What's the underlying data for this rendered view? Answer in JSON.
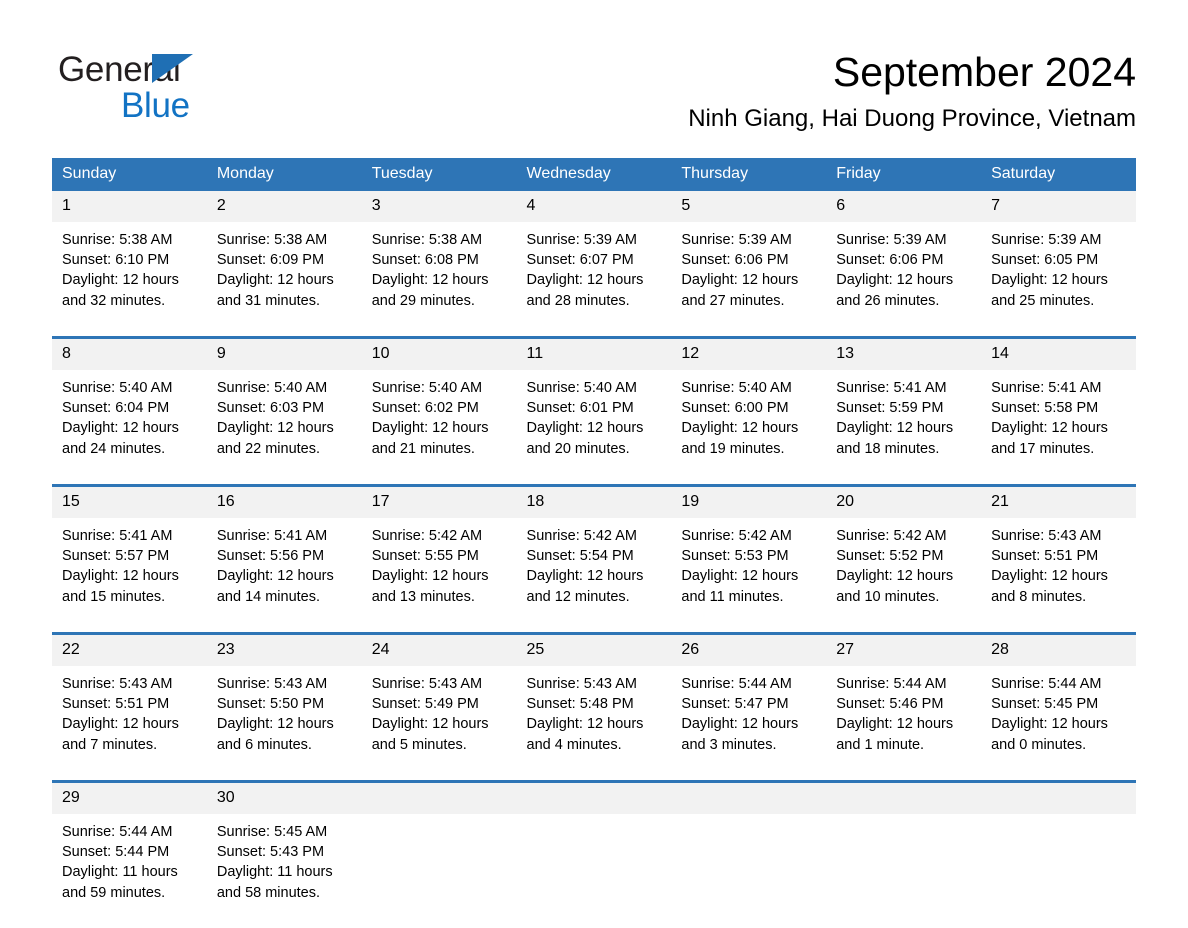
{
  "brand": {
    "name_part1": "General",
    "name_part2": "Blue",
    "accent_color": "#1273c4",
    "triangle_color": "#1f6fb4"
  },
  "header": {
    "title": "September 2024",
    "subtitle": "Ninh Giang, Hai Duong Province, Vietnam"
  },
  "calendar": {
    "header_bg": "#2e75b6",
    "daynum_bg": "#f2f2f2",
    "weekday_headers": [
      "Sunday",
      "Monday",
      "Tuesday",
      "Wednesday",
      "Thursday",
      "Friday",
      "Saturday"
    ],
    "weeks": [
      [
        {
          "day": "1",
          "sunrise": "Sunrise: 5:38 AM",
          "sunset": "Sunset: 6:10 PM",
          "daylight_line1": "Daylight: 12 hours",
          "daylight_line2": "and 32 minutes."
        },
        {
          "day": "2",
          "sunrise": "Sunrise: 5:38 AM",
          "sunset": "Sunset: 6:09 PM",
          "daylight_line1": "Daylight: 12 hours",
          "daylight_line2": "and 31 minutes."
        },
        {
          "day": "3",
          "sunrise": "Sunrise: 5:38 AM",
          "sunset": "Sunset: 6:08 PM",
          "daylight_line1": "Daylight: 12 hours",
          "daylight_line2": "and 29 minutes."
        },
        {
          "day": "4",
          "sunrise": "Sunrise: 5:39 AM",
          "sunset": "Sunset: 6:07 PM",
          "daylight_line1": "Daylight: 12 hours",
          "daylight_line2": "and 28 minutes."
        },
        {
          "day": "5",
          "sunrise": "Sunrise: 5:39 AM",
          "sunset": "Sunset: 6:06 PM",
          "daylight_line1": "Daylight: 12 hours",
          "daylight_line2": "and 27 minutes."
        },
        {
          "day": "6",
          "sunrise": "Sunrise: 5:39 AM",
          "sunset": "Sunset: 6:06 PM",
          "daylight_line1": "Daylight: 12 hours",
          "daylight_line2": "and 26 minutes."
        },
        {
          "day": "7",
          "sunrise": "Sunrise: 5:39 AM",
          "sunset": "Sunset: 6:05 PM",
          "daylight_line1": "Daylight: 12 hours",
          "daylight_line2": "and 25 minutes."
        }
      ],
      [
        {
          "day": "8",
          "sunrise": "Sunrise: 5:40 AM",
          "sunset": "Sunset: 6:04 PM",
          "daylight_line1": "Daylight: 12 hours",
          "daylight_line2": "and 24 minutes."
        },
        {
          "day": "9",
          "sunrise": "Sunrise: 5:40 AM",
          "sunset": "Sunset: 6:03 PM",
          "daylight_line1": "Daylight: 12 hours",
          "daylight_line2": "and 22 minutes."
        },
        {
          "day": "10",
          "sunrise": "Sunrise: 5:40 AM",
          "sunset": "Sunset: 6:02 PM",
          "daylight_line1": "Daylight: 12 hours",
          "daylight_line2": "and 21 minutes."
        },
        {
          "day": "11",
          "sunrise": "Sunrise: 5:40 AM",
          "sunset": "Sunset: 6:01 PM",
          "daylight_line1": "Daylight: 12 hours",
          "daylight_line2": "and 20 minutes."
        },
        {
          "day": "12",
          "sunrise": "Sunrise: 5:40 AM",
          "sunset": "Sunset: 6:00 PM",
          "daylight_line1": "Daylight: 12 hours",
          "daylight_line2": "and 19 minutes."
        },
        {
          "day": "13",
          "sunrise": "Sunrise: 5:41 AM",
          "sunset": "Sunset: 5:59 PM",
          "daylight_line1": "Daylight: 12 hours",
          "daylight_line2": "and 18 minutes."
        },
        {
          "day": "14",
          "sunrise": "Sunrise: 5:41 AM",
          "sunset": "Sunset: 5:58 PM",
          "daylight_line1": "Daylight: 12 hours",
          "daylight_line2": "and 17 minutes."
        }
      ],
      [
        {
          "day": "15",
          "sunrise": "Sunrise: 5:41 AM",
          "sunset": "Sunset: 5:57 PM",
          "daylight_line1": "Daylight: 12 hours",
          "daylight_line2": "and 15 minutes."
        },
        {
          "day": "16",
          "sunrise": "Sunrise: 5:41 AM",
          "sunset": "Sunset: 5:56 PM",
          "daylight_line1": "Daylight: 12 hours",
          "daylight_line2": "and 14 minutes."
        },
        {
          "day": "17",
          "sunrise": "Sunrise: 5:42 AM",
          "sunset": "Sunset: 5:55 PM",
          "daylight_line1": "Daylight: 12 hours",
          "daylight_line2": "and 13 minutes."
        },
        {
          "day": "18",
          "sunrise": "Sunrise: 5:42 AM",
          "sunset": "Sunset: 5:54 PM",
          "daylight_line1": "Daylight: 12 hours",
          "daylight_line2": "and 12 minutes."
        },
        {
          "day": "19",
          "sunrise": "Sunrise: 5:42 AM",
          "sunset": "Sunset: 5:53 PM",
          "daylight_line1": "Daylight: 12 hours",
          "daylight_line2": "and 11 minutes."
        },
        {
          "day": "20",
          "sunrise": "Sunrise: 5:42 AM",
          "sunset": "Sunset: 5:52 PM",
          "daylight_line1": "Daylight: 12 hours",
          "daylight_line2": "and 10 minutes."
        },
        {
          "day": "21",
          "sunrise": "Sunrise: 5:43 AM",
          "sunset": "Sunset: 5:51 PM",
          "daylight_line1": "Daylight: 12 hours",
          "daylight_line2": "and 8 minutes."
        }
      ],
      [
        {
          "day": "22",
          "sunrise": "Sunrise: 5:43 AM",
          "sunset": "Sunset: 5:51 PM",
          "daylight_line1": "Daylight: 12 hours",
          "daylight_line2": "and 7 minutes."
        },
        {
          "day": "23",
          "sunrise": "Sunrise: 5:43 AM",
          "sunset": "Sunset: 5:50 PM",
          "daylight_line1": "Daylight: 12 hours",
          "daylight_line2": "and 6 minutes."
        },
        {
          "day": "24",
          "sunrise": "Sunrise: 5:43 AM",
          "sunset": "Sunset: 5:49 PM",
          "daylight_line1": "Daylight: 12 hours",
          "daylight_line2": "and 5 minutes."
        },
        {
          "day": "25",
          "sunrise": "Sunrise: 5:43 AM",
          "sunset": "Sunset: 5:48 PM",
          "daylight_line1": "Daylight: 12 hours",
          "daylight_line2": "and 4 minutes."
        },
        {
          "day": "26",
          "sunrise": "Sunrise: 5:44 AM",
          "sunset": "Sunset: 5:47 PM",
          "daylight_line1": "Daylight: 12 hours",
          "daylight_line2": "and 3 minutes."
        },
        {
          "day": "27",
          "sunrise": "Sunrise: 5:44 AM",
          "sunset": "Sunset: 5:46 PM",
          "daylight_line1": "Daylight: 12 hours",
          "daylight_line2": "and 1 minute."
        },
        {
          "day": "28",
          "sunrise": "Sunrise: 5:44 AM",
          "sunset": "Sunset: 5:45 PM",
          "daylight_line1": "Daylight: 12 hours",
          "daylight_line2": "and 0 minutes."
        }
      ],
      [
        {
          "day": "29",
          "sunrise": "Sunrise: 5:44 AM",
          "sunset": "Sunset: 5:44 PM",
          "daylight_line1": "Daylight: 11 hours",
          "daylight_line2": "and 59 minutes."
        },
        {
          "day": "30",
          "sunrise": "Sunrise: 5:45 AM",
          "sunset": "Sunset: 5:43 PM",
          "daylight_line1": "Daylight: 11 hours",
          "daylight_line2": "and 58 minutes."
        },
        {
          "day": "",
          "sunrise": "",
          "sunset": "",
          "daylight_line1": "",
          "daylight_line2": ""
        },
        {
          "day": "",
          "sunrise": "",
          "sunset": "",
          "daylight_line1": "",
          "daylight_line2": ""
        },
        {
          "day": "",
          "sunrise": "",
          "sunset": "",
          "daylight_line1": "",
          "daylight_line2": ""
        },
        {
          "day": "",
          "sunrise": "",
          "sunset": "",
          "daylight_line1": "",
          "daylight_line2": ""
        },
        {
          "day": "",
          "sunrise": "",
          "sunset": "",
          "daylight_line1": "",
          "daylight_line2": ""
        }
      ]
    ]
  }
}
